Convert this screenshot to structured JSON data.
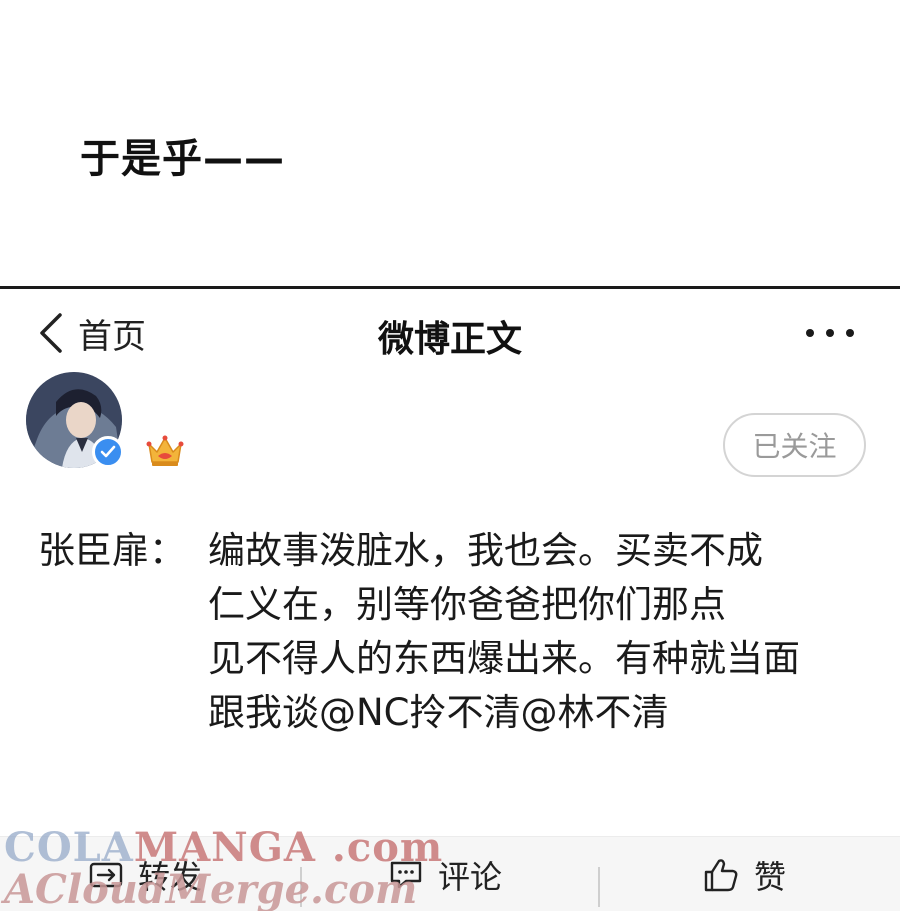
{
  "caption": "于是乎——",
  "header": {
    "back_label": "首页",
    "title": "微博正文"
  },
  "profile": {
    "follow_label": "已关注"
  },
  "post": {
    "speaker": "张臣扉：",
    "lines": [
      "编故事泼脏水，我也会。买卖不成",
      "仁义在，别等你爸爸把你们那点",
      "见不得人的东西爆出来。有种就当面",
      "跟我谈@NC拎不清@林不清"
    ]
  },
  "actions": {
    "repost_label": "转发",
    "comment_label": "评论",
    "like_label": "赞"
  },
  "watermark": {
    "line1_part1": "COLA",
    "line1_part2": "MANGA",
    "line1_part3": ".com",
    "line2": "ACloudMerge.com"
  },
  "colors": {
    "verified_badge": "#3a8ef0",
    "follow_text": "#9a9a9a",
    "action_bar_bg": "#f6f6f6"
  },
  "icons": {
    "back": "chevron-left-icon",
    "more": "more-dots-icon",
    "verified": "verified-check-icon",
    "crown": "crown-icon",
    "repost": "repost-icon",
    "comment": "comment-icon",
    "like": "thumbs-up-icon"
  }
}
